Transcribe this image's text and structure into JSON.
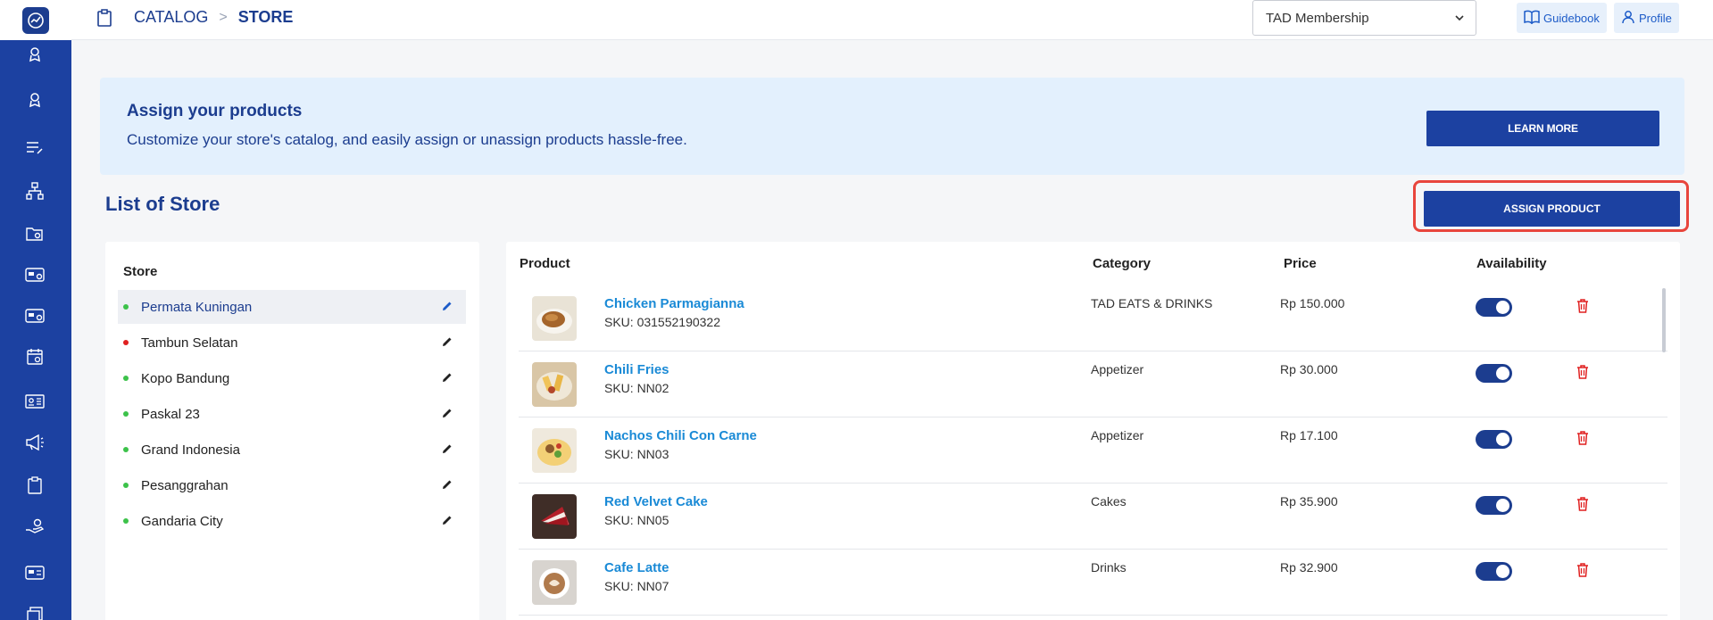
{
  "breadcrumb": {
    "parent": "CATALOG",
    "separator": ">",
    "current": "STORE"
  },
  "header": {
    "membership_select": "TAD Membership",
    "guidebook_label": "Guidebook",
    "profile_label": "Profile"
  },
  "banner": {
    "title": "Assign your products",
    "text": "Customize your store's catalog, and easily assign or unassign products hassle-free.",
    "learn_more": "LEARN MORE"
  },
  "list_title": "List of Store",
  "assign_button": "ASSIGN PRODUCT",
  "stores": {
    "header": "Store",
    "items": [
      {
        "name": "Permata Kuningan",
        "status_color": "#3cc24a",
        "active": true
      },
      {
        "name": "Tambun Selatan",
        "status_color": "#e02020",
        "active": false
      },
      {
        "name": "Kopo Bandung",
        "status_color": "#3cc24a",
        "active": false
      },
      {
        "name": "Paskal 23",
        "status_color": "#3cc24a",
        "active": false
      },
      {
        "name": "Grand Indonesia",
        "status_color": "#3cc24a",
        "active": false
      },
      {
        "name": "Pesanggrahan",
        "status_color": "#3cc24a",
        "active": false
      },
      {
        "name": "Gandaria City",
        "status_color": "#3cc24a",
        "active": false
      }
    ]
  },
  "products": {
    "columns": [
      "Product",
      "Category",
      "Price",
      "Availability"
    ],
    "rows": [
      {
        "name": "Chicken Parmagianna",
        "sku": "SKU: 031552190322",
        "category": "TAD EATS & DRINKS",
        "price": "Rp 150.000",
        "available": true
      },
      {
        "name": "Chili Fries",
        "sku": "SKU: NN02",
        "category": "Appetizer",
        "price": "Rp 30.000",
        "available": true
      },
      {
        "name": "Nachos Chili Con Carne",
        "sku": "SKU: NN03",
        "category": "Appetizer",
        "price": "Rp 17.100",
        "available": true
      },
      {
        "name": "Red Velvet Cake",
        "sku": "SKU: NN05",
        "category": "Cakes",
        "price": "Rp 35.900",
        "available": true
      },
      {
        "name": "Cafe Latte",
        "sku": "SKU: NN07",
        "category": "Drinks",
        "price": "Rp 32.900",
        "available": true
      }
    ]
  },
  "colors": {
    "primary": "#1c41a1",
    "link": "#1a8ad6",
    "danger": "#e02020",
    "highlight_border": "#e8453c"
  }
}
